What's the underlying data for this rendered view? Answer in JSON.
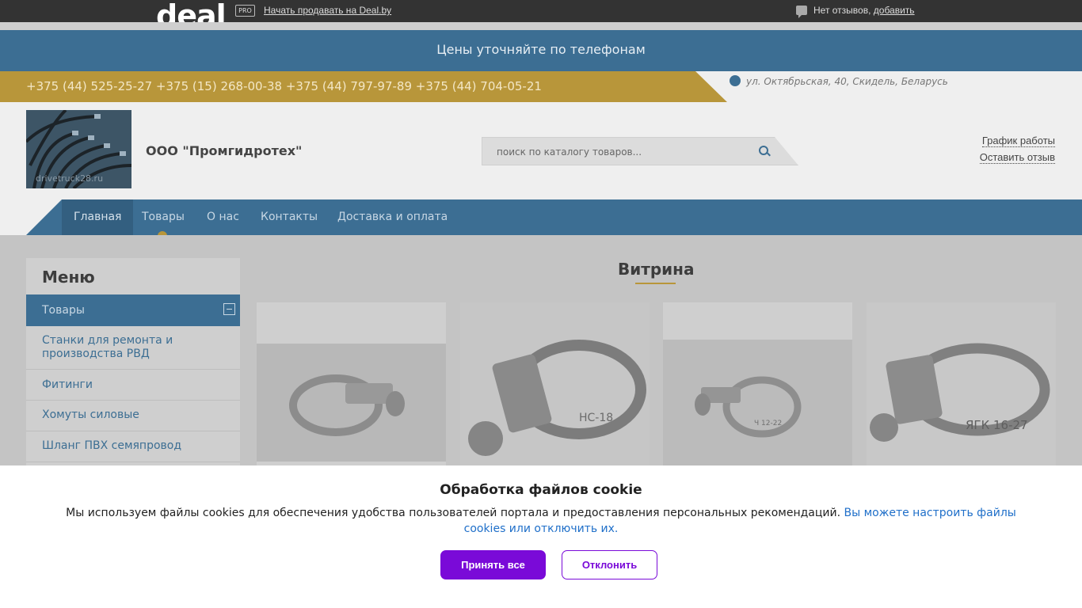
{
  "topbar": {
    "logo": "deal",
    "pro_badge": "PRO",
    "sell_link": "Начать продавать на Deal.by",
    "reviews_text": "Нет отзывов,",
    "reviews_add": "добавить"
  },
  "banner": {
    "text": "Цены уточняйте по телефонам"
  },
  "contacts": {
    "phones": "+375 (44) 525-25-27 +375 (15) 268-00-38 +375 (44) 797-97-89 +375 (44) 704-05-21",
    "address": "ул. Октябрьская, 40, Скидель, Беларусь"
  },
  "header": {
    "logo_watermark": "drivetruck28.ru",
    "company": "ООО \"Промгидротех\"",
    "search_placeholder": "поиск по каталогу товаров...",
    "schedule_link": "График работы",
    "review_link": "Оставить отзыв"
  },
  "nav": {
    "items": [
      "Главная",
      "Товары",
      "О нас",
      "Контакты",
      "Доставка и оплата"
    ],
    "active_index": 0
  },
  "sidebar": {
    "title": "Меню",
    "active_item": "Товары",
    "items": [
      "Станки для ремонта и производства РВД",
      "Фитинги",
      "Хомуты силовые",
      "Шланг ПВХ семяпровод"
    ]
  },
  "showcase": {
    "title": "Витрина",
    "card_labels": [
      "",
      "",
      "Ч 12-22",
      "ЯГК 16-27"
    ],
    "card_label_2": "НС-18"
  },
  "cookie": {
    "title": "Обработка файлов cookie",
    "text": "Мы используем файлы cookies для обеспечения удобства пользователей портала и предоставления персональных рекомендаций.",
    "link": "Вы можете настроить файлы cookies или отключить их.",
    "accept": "Принять все",
    "reject": "Отклонить"
  },
  "colors": {
    "brand_blue": "#3c6e93",
    "accent_gold": "#b8963a",
    "cookie_purple": "#7a0ad8"
  }
}
